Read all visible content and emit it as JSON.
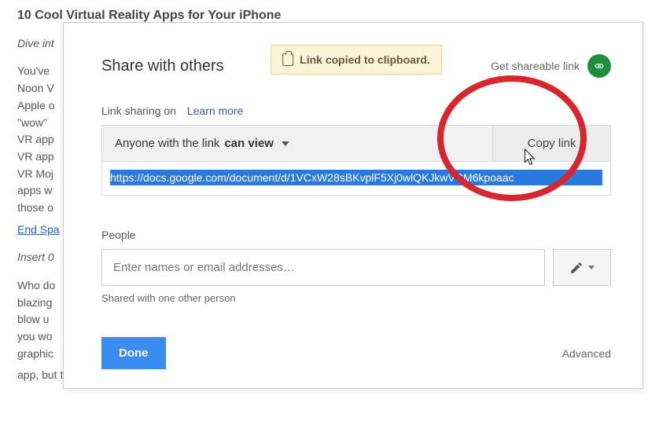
{
  "background": {
    "title": "10 Cool Virtual Reality Apps for Your iPhone",
    "intro_italic": "Dive int",
    "para1_lines": [
      "You've",
      "Noon V",
      "Apple o",
      "\"wow\"",
      "VR app",
      "VR app",
      "VR Moj",
      "apps w",
      "those o"
    ],
    "link_text": "End Spa",
    "insert_italic": "Insert 0",
    "para3_lines": [
      "Who do",
      "blazing",
      "blow u",
      "you wo",
      "graphic"
    ],
    "tail_line": "app, but the admission price is more than worth the ride."
  },
  "dialog": {
    "title": "Share with others",
    "toast": "Link copied to clipboard.",
    "get_shareable": "Get shareable link",
    "sharing_on": "Link sharing on",
    "learn_more": "Learn more",
    "permission_prefix": "Anyone with the link ",
    "permission_bold": "can view",
    "copy_link": "Copy link",
    "url": "https://docs.google.com/document/d/1VCxW28sBKvplF5Xj0wlQKJkwVCM6kpoaac",
    "people_label": "People",
    "people_placeholder": "Enter names or email addresses…",
    "shared_note": "Shared with one other person",
    "done": "Done",
    "advanced": "Advanced"
  }
}
